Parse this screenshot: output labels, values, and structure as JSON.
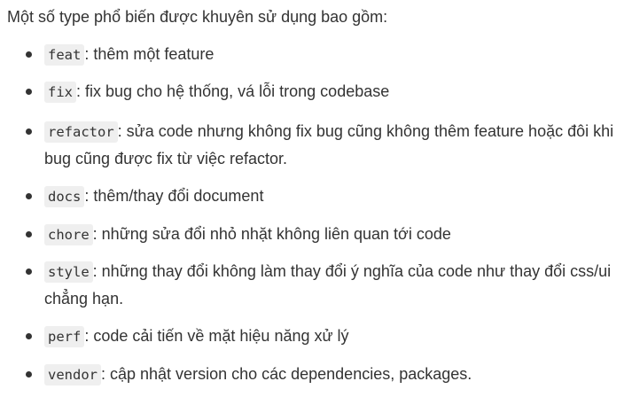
{
  "intro": "Một số type phổ biến được khuyên sử dụng bao gồm:",
  "items": [
    {
      "code": "feat",
      "desc": ": thêm một feature"
    },
    {
      "code": "fix",
      "desc": ": fix bug cho hệ thống, vá lỗi trong codebase"
    },
    {
      "code": "refactor",
      "desc": ": sửa code nhưng không fix bug cũng không thêm feature hoặc đôi khi bug cũng được fix từ việc refactor."
    },
    {
      "code": "docs",
      "desc": ": thêm/thay đổi document"
    },
    {
      "code": "chore",
      "desc": ": những sửa đổi nhỏ nhặt không liên quan tới code"
    },
    {
      "code": "style",
      "desc": ": những thay đổi không làm thay đổi ý nghĩa của code như thay đổi css/ui chẳng hạn."
    },
    {
      "code": "perf",
      "desc": ": code cải tiến về mặt hiệu năng xử lý"
    },
    {
      "code": "vendor",
      "desc": ": cập nhật version cho các dependencies, packages."
    }
  ]
}
